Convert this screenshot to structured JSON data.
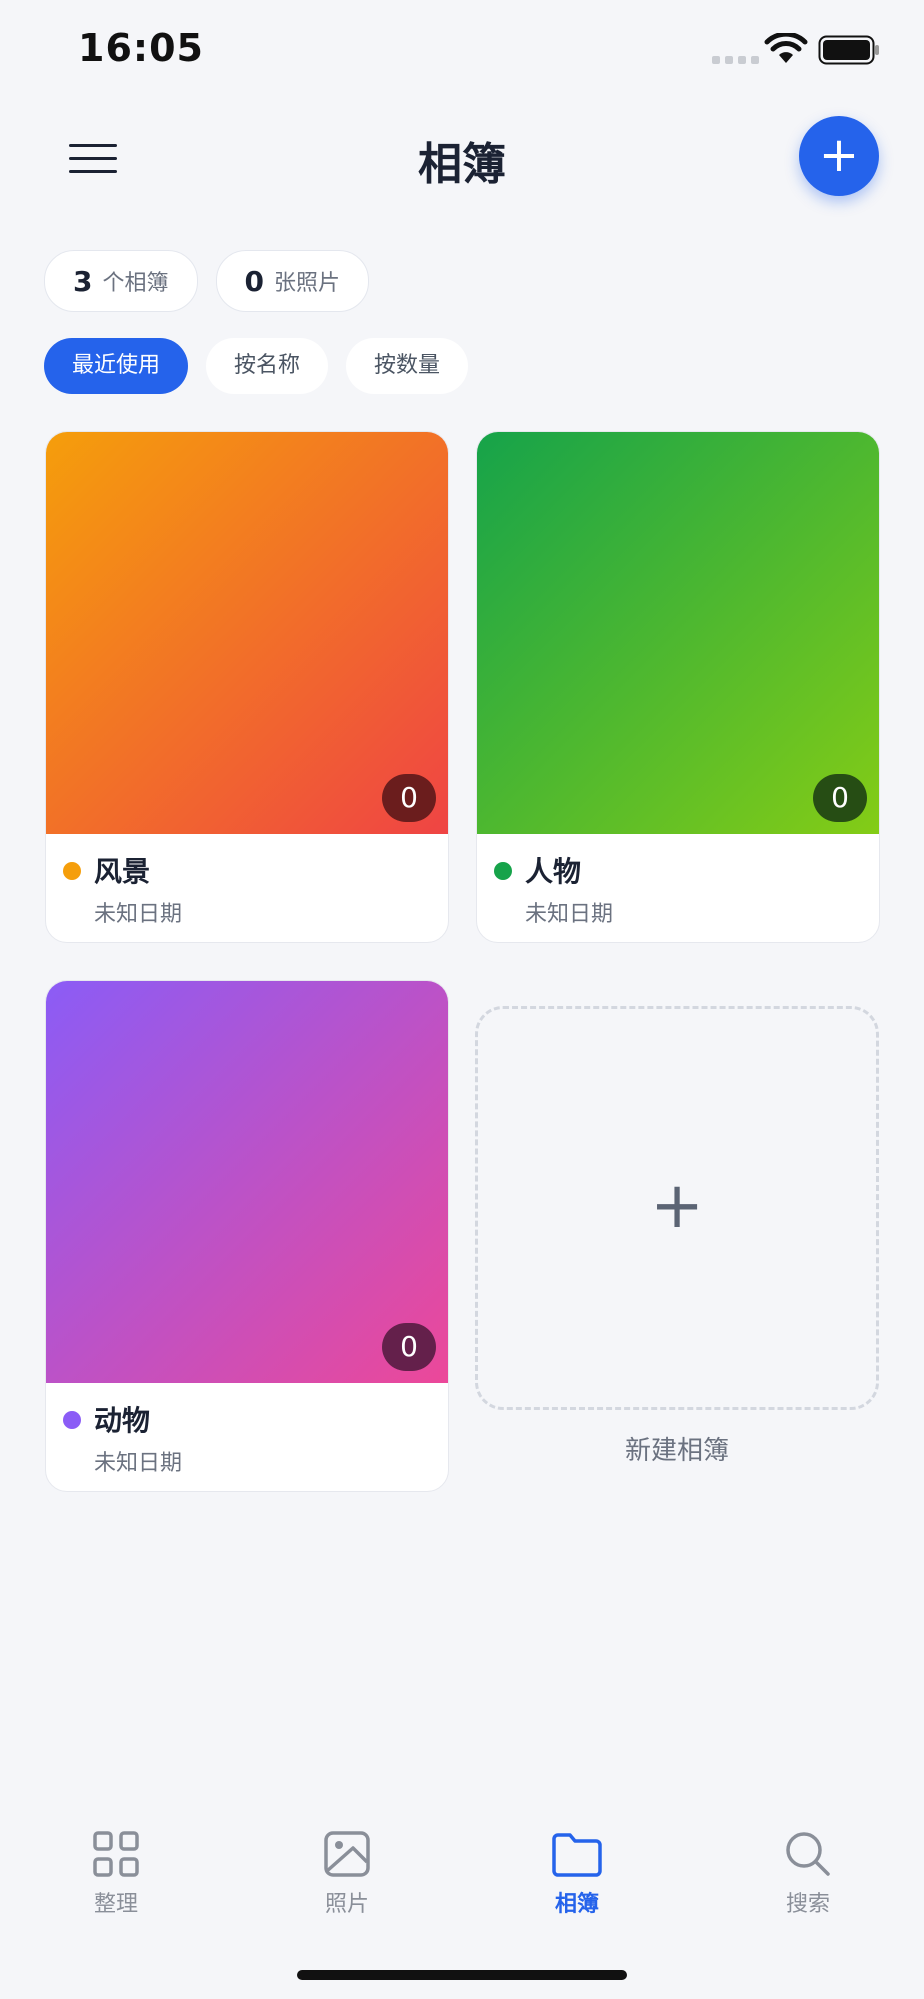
{
  "status": {
    "time": "16:05"
  },
  "header": {
    "title": "相簿",
    "add_label": "+"
  },
  "stats": [
    {
      "value": "3",
      "label": "个相簿"
    },
    {
      "value": "0",
      "label": "张照片"
    }
  ],
  "sort": {
    "options": [
      "最近使用",
      "按名称",
      "按数量"
    ],
    "active": "最近使用"
  },
  "albums": [
    {
      "name": "风景",
      "date": "未知日期",
      "count": "0",
      "colors": [
        "#f59e0b",
        "#ef4444"
      ],
      "dot": "#f59e0b",
      "badge": "#6b1d1d"
    },
    {
      "name": "人物",
      "date": "未知日期",
      "count": "0",
      "colors": [
        "#16a34a",
        "#84cc16"
      ],
      "dot": "#16a34a",
      "badge": "#264d14"
    },
    {
      "name": "动物",
      "date": "未知日期",
      "count": "0",
      "colors": [
        "#8b5cf6",
        "#ec4899"
      ],
      "dot": "#8b5cf6",
      "badge": "#64204b"
    }
  ],
  "new_album": {
    "plus": "+",
    "label": "新建相簿"
  },
  "tabs": [
    {
      "label": "整理",
      "icon": "grid-icon"
    },
    {
      "label": "照片",
      "icon": "image-icon"
    },
    {
      "label": "相簿",
      "icon": "folder-icon"
    },
    {
      "label": "搜索",
      "icon": "search-icon"
    }
  ],
  "active_tab": "相簿",
  "accent": "#2563eb"
}
